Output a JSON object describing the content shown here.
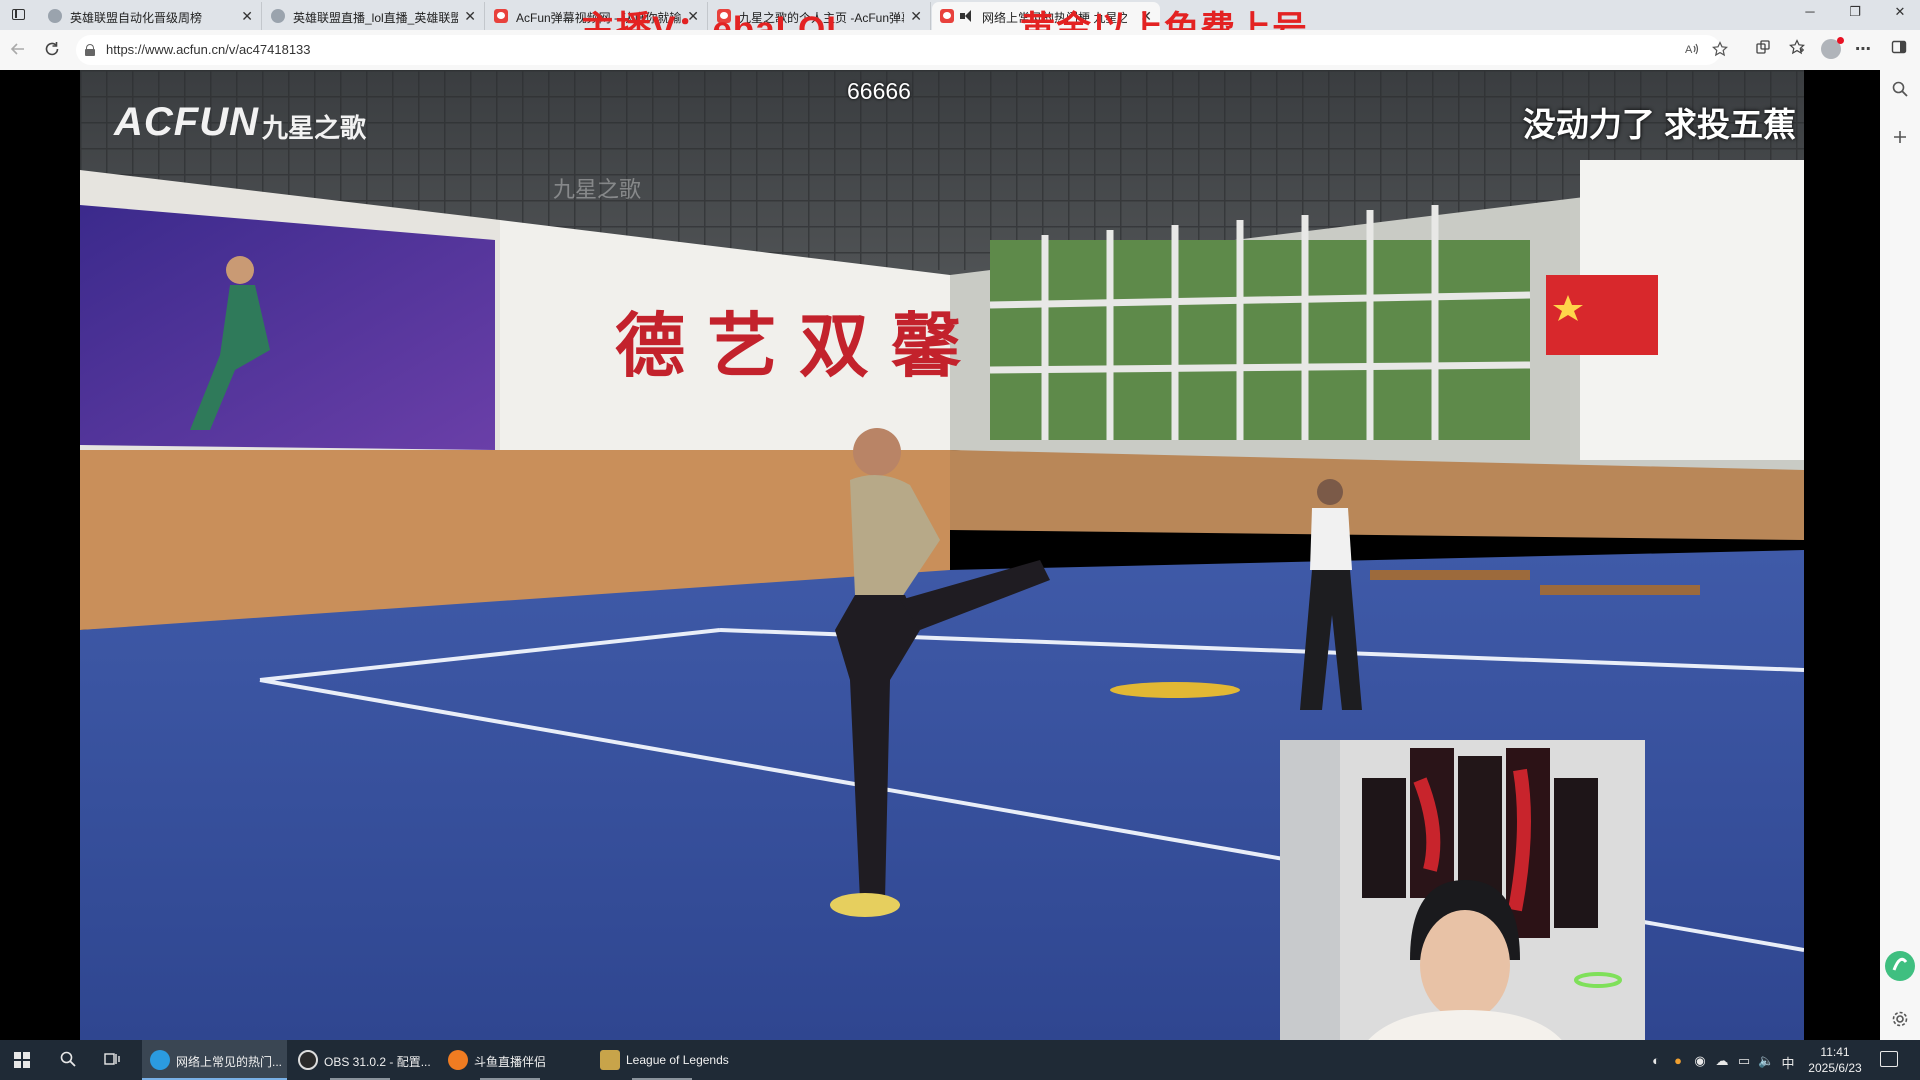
{
  "browser": {
    "tabs": [
      {
        "title": "英雄联盟自动化晋级周榜",
        "favicon": "lol",
        "active": false
      },
      {
        "title": "英雄联盟直播_lol直播_英雄联盟",
        "favicon": "lol",
        "active": false
      },
      {
        "title": "AcFun弹幕视频网 - 认真你就输啦",
        "favicon": "acfun",
        "active": false
      },
      {
        "title": "九星之歌的个人主页 -AcFun弹幕",
        "favicon": "acfun",
        "active": false
      },
      {
        "title": "网络上常见的热门梗 九星之歌",
        "favicon": "acfun",
        "active": true,
        "audio": true
      }
    ],
    "close_glyph": "✕",
    "window_controls": {
      "minimize": "─",
      "restore": "❐",
      "close": "✕"
    },
    "url": "https://www.acfun.cn/v/ac47418133",
    "icons": {
      "back": "back-arrow-icon",
      "reload": "reload-icon",
      "read_aloud": "read-aloud-icon",
      "favorite": "star-icon",
      "extensions": "extensions-icon",
      "collections": "collections-icon",
      "profile": "profile-avatar-icon",
      "more": "more-icon",
      "sidebar_toggle": "sidebar-icon"
    }
  },
  "overlay": {
    "left_text": "主播V：ebaLOL",
    "right_text": "黄金以上免费上号",
    "color": "#e32222"
  },
  "video": {
    "logo": "ACFUN",
    "channel": "九星之歌",
    "faint_watermark": "九星之歌",
    "danmaku": "66666",
    "caption": "没动力了 求投五蕉",
    "wall_slogan": "德艺双馨"
  },
  "sidepanel": {
    "icons": [
      "search-icon",
      "add-icon",
      "settings-icon"
    ]
  },
  "taskbar": {
    "apps": [
      {
        "label": "网络上常见的热门...",
        "icon": "edge-icon",
        "active": true
      },
      {
        "label": "OBS 31.0.2 - 配置...",
        "icon": "obs-icon",
        "active": false
      },
      {
        "label": "斗鱼直播伴侣",
        "icon": "douyu-icon",
        "active": false
      },
      {
        "label": "League of Legends",
        "icon": "lol-icon",
        "active": false
      }
    ],
    "tray_input_method": "中",
    "clock_time": "11:41",
    "clock_date": "2025/6/23"
  }
}
